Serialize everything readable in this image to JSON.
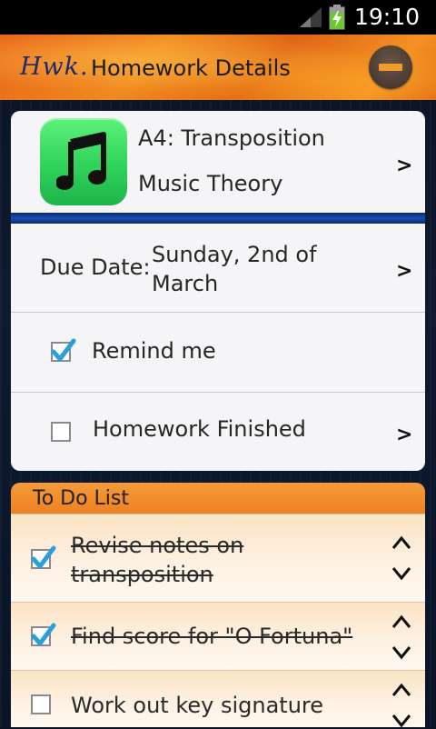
{
  "status_bar": {
    "time": "19:10"
  },
  "action_bar": {
    "logo": "Hwk.",
    "title": "Homework Details",
    "delete_icon": "remove-icon"
  },
  "homework": {
    "title": "A4: Transposition",
    "subject": "Music Theory",
    "subject_icon": "music-note-icon",
    "chevron": ">"
  },
  "due": {
    "label": "Due Date:",
    "value": "Sunday, 2nd of March",
    "chevron": ">"
  },
  "remind": {
    "label": "Remind me",
    "checked": true
  },
  "finished": {
    "label": "Homework Finished",
    "checked": false,
    "chevron": ">"
  },
  "todo": {
    "header": "To Do List",
    "items": [
      {
        "text": "Revise notes on transposition",
        "done": true
      },
      {
        "text": "Find score for \"O Fortuna\"",
        "done": true
      },
      {
        "text": "Work out key signature",
        "done": false
      }
    ]
  },
  "colors": {
    "accent_orange": "#ee8122",
    "check_blue": "#2a9fd8",
    "icon_green": "#2fd35a"
  }
}
